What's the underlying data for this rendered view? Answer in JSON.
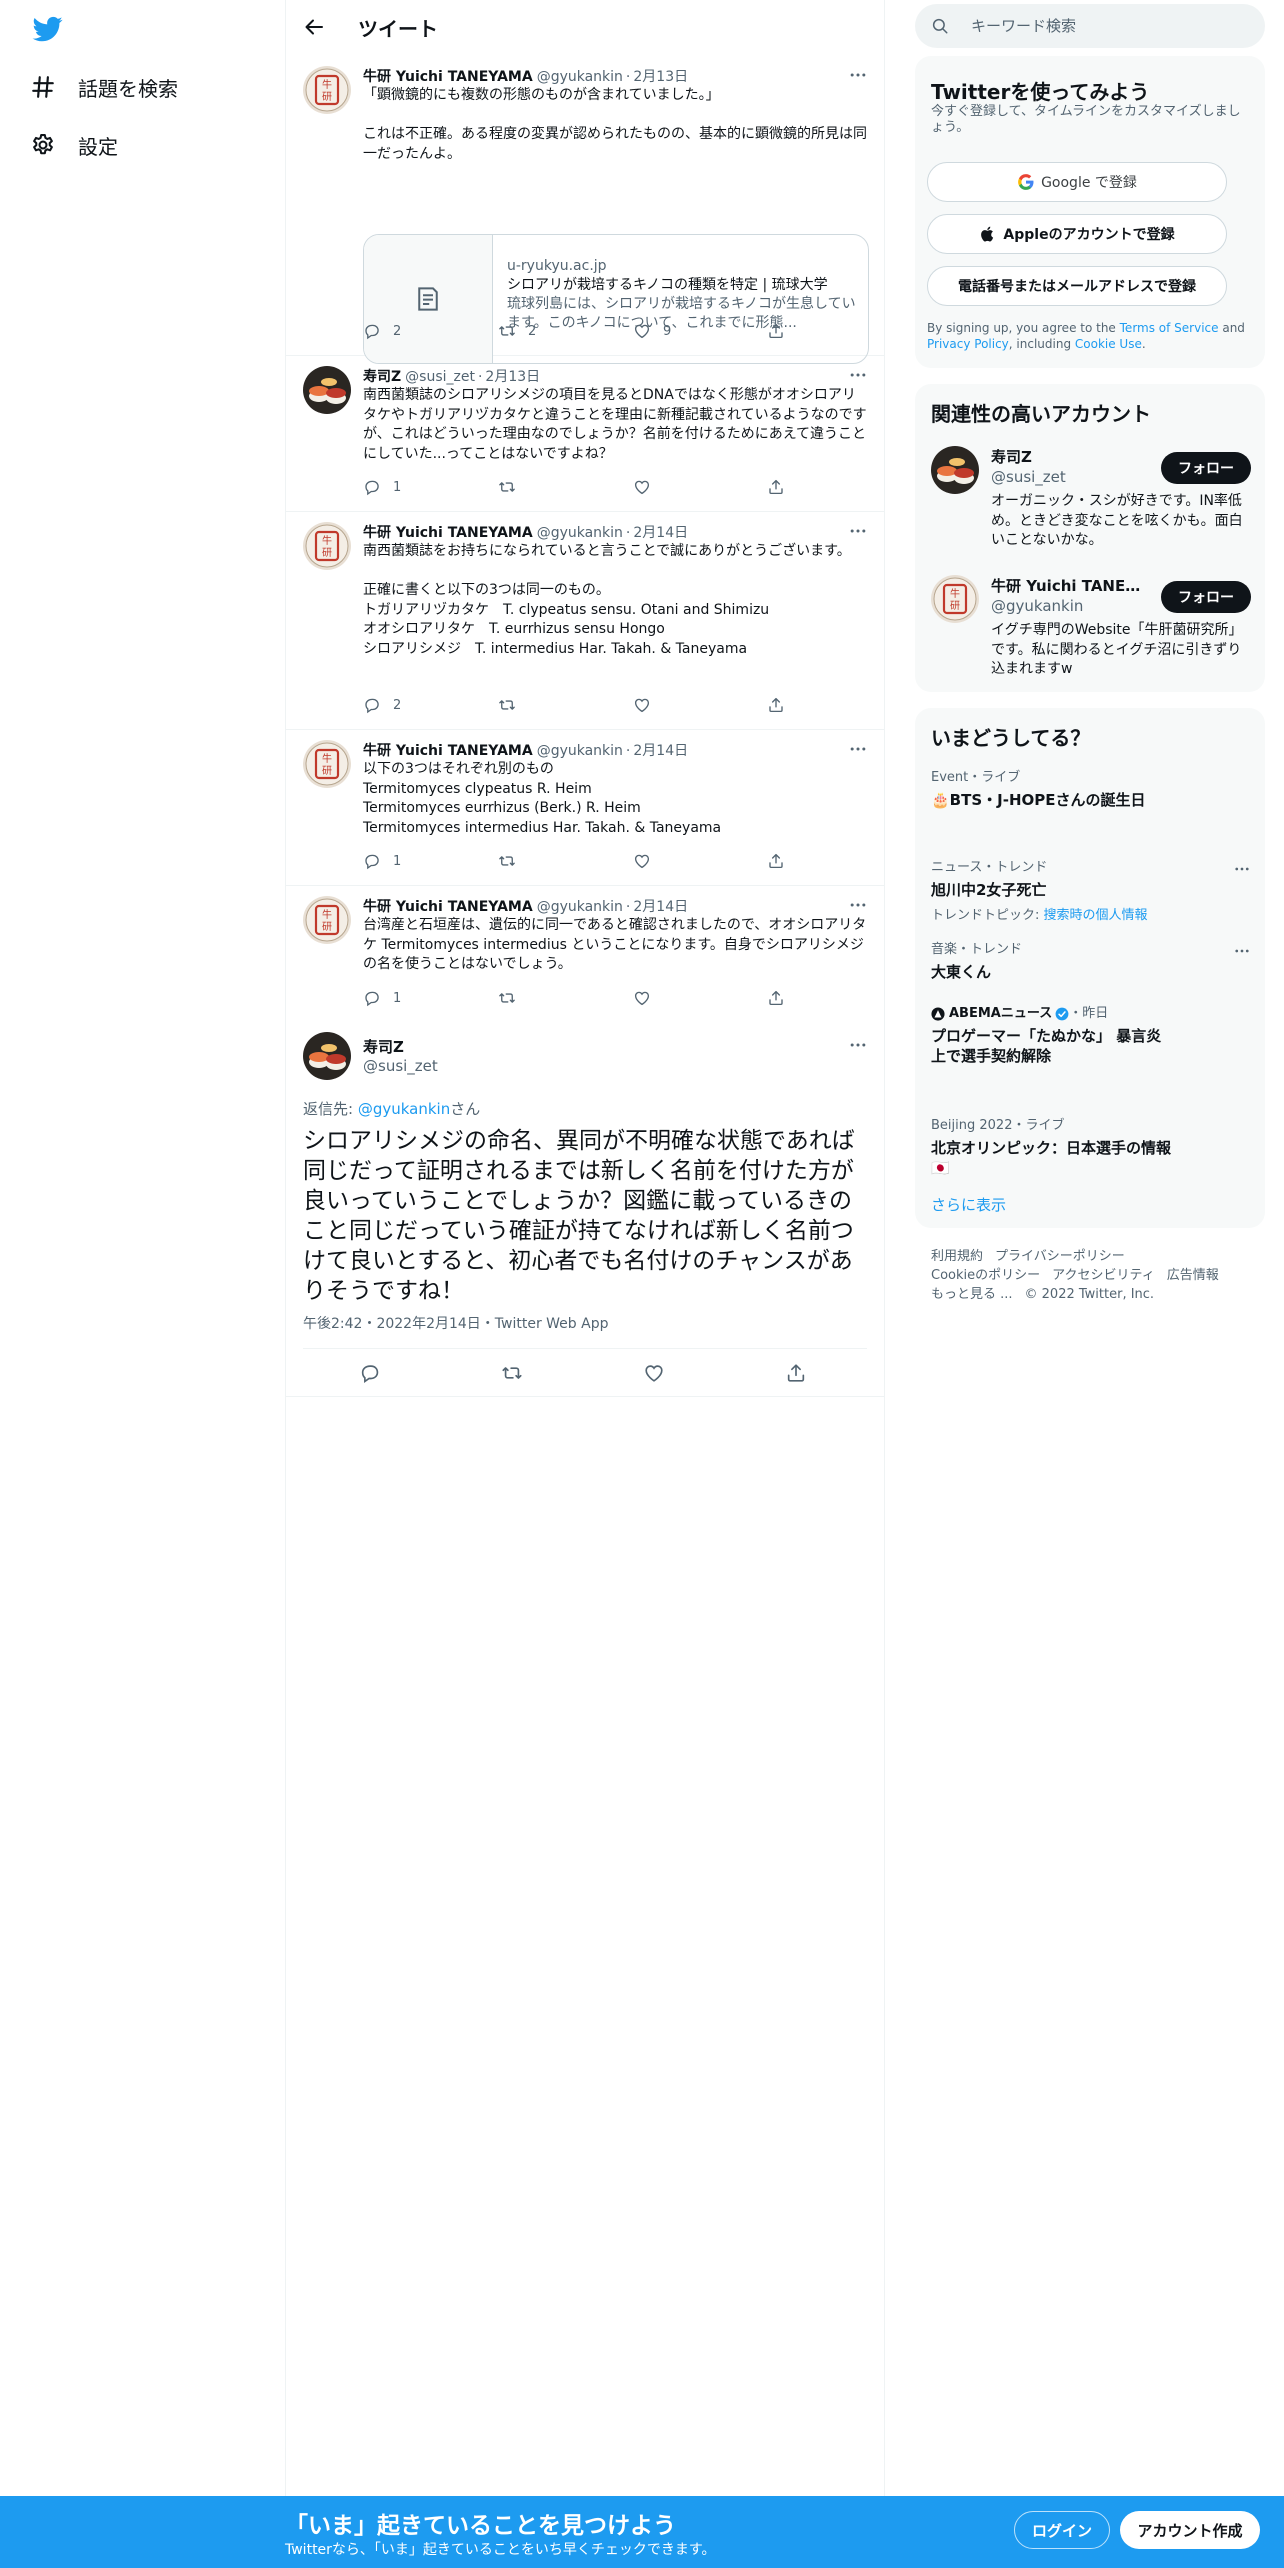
{
  "colors": {
    "brand": "#1d9bf0",
    "text": "#0f1419",
    "secondary": "#536471",
    "panel": "#f7f9f9"
  },
  "nav": {
    "logo_icon": "twitter-bird-icon",
    "explore_label": "話題を検索",
    "settings_label": "設定"
  },
  "main": {
    "header_title": "ツイート",
    "tweets": [
      {
        "name": "牛研 Yuichi TANEYAMA",
        "handle": "@gyukankin",
        "date": "2月13日",
        "text": "「顕微鏡的にも複数の形態のものが含まれていました。」\n\nこれは不正確。ある程度の変異が認められたものの、基本的に顕微鏡的所見は同一だったんよ。",
        "card": {
          "domain": "u-ryukyu.ac.jp",
          "title": "シロアリが栽培するキノコの種類を特定 | 琉球大学",
          "desc": "琉球列島には、シロアリが栽培するキノコが生息しています。このキノコについて、これまでに形態..."
        },
        "reply_count": "2",
        "retweet_count": "2",
        "like_count": "9"
      },
      {
        "name": "寿司Z",
        "handle": "@susi_zet",
        "date": "2月13日",
        "text": "南西菌類誌のシロアリシメジの項目を見るとDNAではなく形態がオオシロアリタケやトガリアリヅカタケと違うことを理由に新種記載されているようなのですが、これはどういった理由なのでしょうか？名前を付けるためにあえて違うことにしていた...ってことはないですよね？",
        "reply_count": "1",
        "retweet_count": "",
        "like_count": ""
      },
      {
        "name": "牛研 Yuichi TANEYAMA",
        "handle": "@gyukankin",
        "date": "2月14日",
        "text": "南西菌類誌をお持ちになられていると言うことで誠にありがとうございます。\n\n正確に書くと以下の3つは同一のもの。\nトガリアリヅカタケ　T. clypeatus sensu. Otani and Shimizu\nオオシロアリタケ　T. eurrhizus sensu Hongo\nシロアリシメジ　T. intermedius Har. Takah. & Taneyama",
        "reply_count": "2",
        "retweet_count": "",
        "like_count": ""
      },
      {
        "name": "牛研 Yuichi TANEYAMA",
        "handle": "@gyukankin",
        "date": "2月14日",
        "text": "以下の3つはそれぞれ別のもの\nTermitomyces clypeatus R. Heim\nTermitomyces eurrhizus (Berk.) R. Heim\nTermitomyces intermedius Har. Takah. & Taneyama",
        "reply_count": "1",
        "retweet_count": "",
        "like_count": ""
      },
      {
        "name": "牛研 Yuichi TANEYAMA",
        "handle": "@gyukankin",
        "date": "2月14日",
        "text": "台湾産と石垣産は、遺伝的に同一であると確認されましたので、オオシロアリタケ Termitomyces intermedius ということになります。自身でシロアリシメジの名を使うことはないでしょう。",
        "reply_count": "1",
        "retweet_count": "",
        "like_count": ""
      }
    ],
    "focus": {
      "name": "寿司Z",
      "handle": "@susi_zet",
      "reply_prefix": "返信先: ",
      "reply_mention": "@gyukankin",
      "reply_suffix": "さん",
      "text": "シロアリシメジの命名、異同が不明確な状態であれば同じだって証明されるまでは新しく名前を付けた方が良いっていうことでしょうか？図鑑に載っているきのこと同じだっていう確証が持てなければ新しく名前つけて良いとすると、初心者でも名付けのチャンスがありそうですね！",
      "meta": "午後2:42・2022年2月14日・Twitter Web App"
    }
  },
  "right": {
    "search_placeholder": "キーワード検索",
    "signup": {
      "title": "Twitterを使ってみよう",
      "subtitle": "今すぐ登録して、タイムラインをカスタマイズしましょう。",
      "google_label": "Google で登録",
      "apple_label": "Appleのアカウントで登録",
      "phone_label": "電話番号またはメールアドレスで登録",
      "terms_prefix": "By signing up, you agree to the ",
      "terms_tos": "Terms of Service",
      "terms_and": " and ",
      "terms_privacy": "Privacy Policy",
      "terms_including": ", including ",
      "terms_cookie": "Cookie Use",
      "terms_end": "."
    },
    "relevant": {
      "title": "関連性の高いアカウント",
      "follow_label": "フォロー",
      "accounts": [
        {
          "name": "寿司Z",
          "handle": "@susi_zet",
          "bio": "オーガニック・スシが好きです。IN率低め。ときどき変なことを呟くかも。面白いことないかな。"
        },
        {
          "name": "牛研 Yuichi TANEYAMA",
          "handle": "@gyukankin",
          "bio": "イグチ専門のWebsite「牛肝菌研究所」です。私に関わるとイグチ沼に引きずり込まれますw"
        }
      ]
    },
    "trends": {
      "title": "いまどうしてる？",
      "items": [
        {
          "meta": "Event・ライブ",
          "title": "🎂BTS・J-HOPEさんの誕生日"
        },
        {
          "meta": "ニュース・トレンド",
          "title": "旭川中2女子死亡",
          "sub_prefix": "トレンドトピック: ",
          "sub_link": "搜索時の個人情報"
        },
        {
          "meta": "音楽・トレンド",
          "title": "大東くん"
        },
        {
          "meta": "ABEMAニュース",
          "meta_suffix": "・昨日",
          "title": "プロゲーマー「たぬかな」 暴言炎上で選手契約解除"
        },
        {
          "meta": "Beijing 2022・ライブ",
          "title": "北京オリンピック：日本選手の情報 🇯🇵"
        }
      ],
      "show_more": "さらに表示"
    },
    "footer": {
      "links": [
        "利用規約",
        "プライバシーポリシー",
        "Cookieのポリシー",
        "アクセシビリティ",
        "広告情報",
        "もっと見る ...",
        "© 2022 Twitter, Inc."
      ]
    }
  },
  "bottom": {
    "title": "「いま」起きていることを見つけよう",
    "subtitle": "Twitterなら、「いま」起きていることをいち早くチェックできます。",
    "login_label": "ログイン",
    "signup_label": "アカウント作成"
  }
}
